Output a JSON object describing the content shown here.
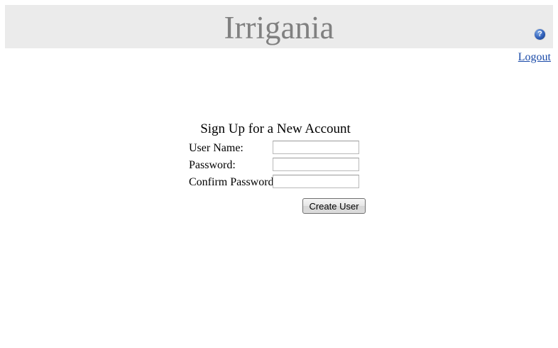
{
  "header": {
    "site_title": "Irrigania",
    "help_icon_glyph": "?",
    "help_icon": "question-circle-icon"
  },
  "nav": {
    "logout_label": "Logout"
  },
  "signup_form": {
    "title": "Sign Up for a New Account",
    "fields": [
      {
        "label": "User Name:",
        "value": "",
        "placeholder": ""
      },
      {
        "label": "Password:",
        "value": "",
        "placeholder": ""
      },
      {
        "label": "Confirm Password:",
        "value": "",
        "placeholder": ""
      }
    ],
    "submit_label": "Create User"
  },
  "colors": {
    "header_bg": "#ebebeb",
    "title_text": "#808080",
    "link": "#1a4aa8"
  }
}
